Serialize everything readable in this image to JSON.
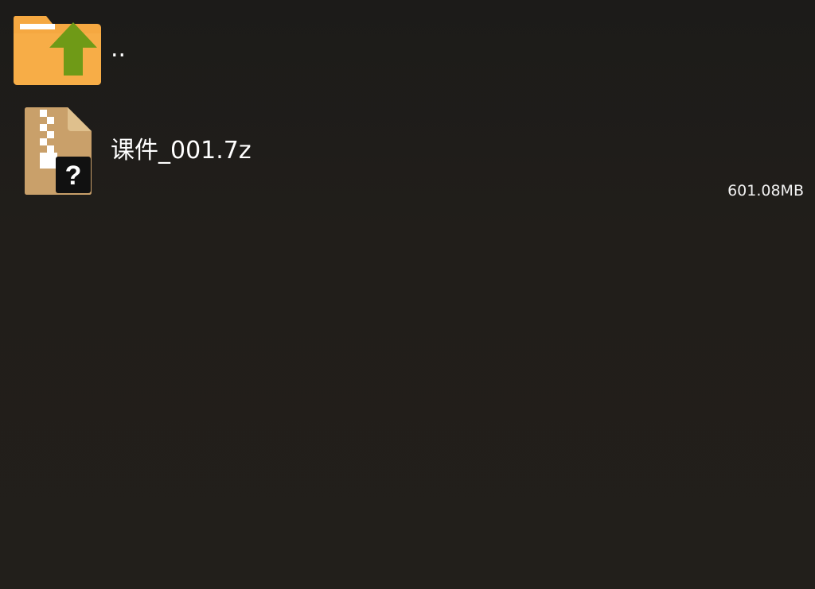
{
  "file_list": {
    "parent": {
      "label": "..",
      "icon": "folder-up-icon"
    },
    "items": [
      {
        "name": "课件_001.7z",
        "size": "601.08MB",
        "icon": "archive-unknown-icon"
      }
    ]
  },
  "colors": {
    "background": "#201d19",
    "folder": "#f5a841",
    "folder_tab": "#ffffff",
    "arrow": "#6f9a17",
    "archive": "#c9a06a"
  }
}
